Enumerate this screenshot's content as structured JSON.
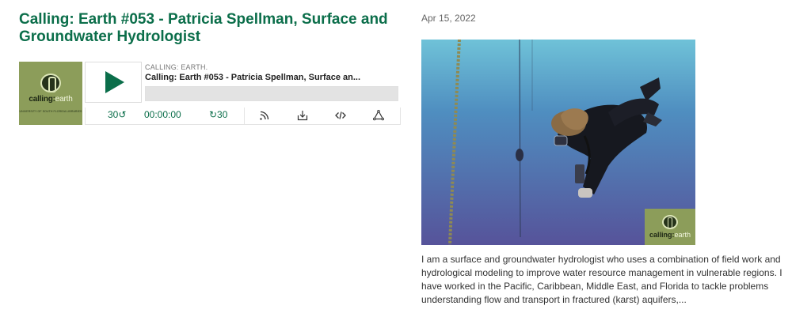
{
  "episode": {
    "title": "Calling: Earth #053 - Patricia Spellman, Surface and Groundwater Hydrologist",
    "date": "Apr 15, 2022",
    "description": "I am a surface and groundwater hydrologist who uses a combination of field work and hydrological modeling to improve water resource management in vulnerable regions. I have worked in the Pacific, Caribbean, Middle East, and Florida to tackle problems understanding flow and transport in fractured (karst) aquifers,..."
  },
  "player": {
    "podcast_name": "CALLING: EARTH.",
    "episode_name": "Calling: Earth #053 - Patricia Spellman, Surface an...",
    "progress": 0,
    "rewind_label": "30↺",
    "current_time": "00:00:00",
    "forward_label": "↻30",
    "icons": [
      "rss-icon",
      "download-icon",
      "embed-icon",
      "share-icon"
    ]
  },
  "cover": {
    "brand_bold": "calling:",
    "brand_light": "earth",
    "institution": "UNIVERSITY OF SOUTH FLORIDA LIBRARIES"
  },
  "photo_logo": {
    "brand_bold": "calling:",
    "brand_light": "earth"
  },
  "colors": {
    "accent": "#0b6e4a",
    "cover_bg": "#8c9d5a",
    "water": "#4f6fa8"
  }
}
